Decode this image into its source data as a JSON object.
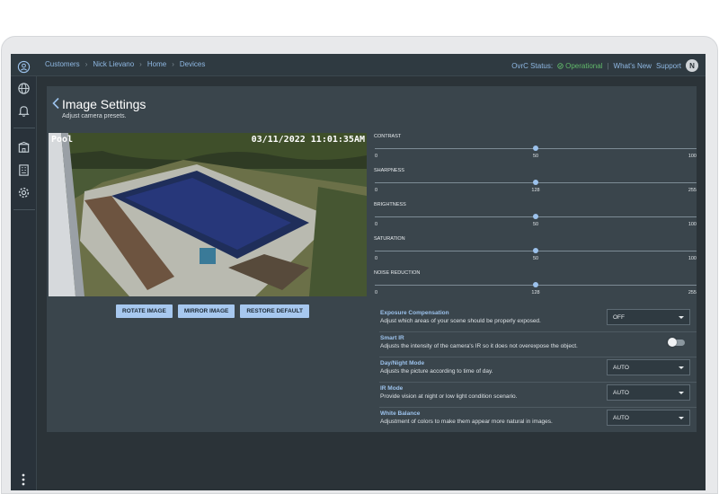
{
  "breadcrumbs": [
    "Customers",
    "Nick Lievano",
    "Home",
    "Devices"
  ],
  "status": {
    "label": "OvrC Status:",
    "value": "Operational",
    "whats_new": "What's New",
    "support": "Support",
    "avatar": "N"
  },
  "page": {
    "title": "Image Settings",
    "subtitle": "Adjust camera presets."
  },
  "camera": {
    "label": "Pool",
    "timestamp": "03/11/2022  11:01:35AM"
  },
  "buttons": {
    "rotate": "ROTATE IMAGE",
    "mirror": "MIRROR IMAGE",
    "restore": "RESTORE DEFAULT"
  },
  "sliders": [
    {
      "label": "CONTRAST",
      "min": "0",
      "value": "50",
      "max": "100",
      "fraction": 0.5
    },
    {
      "label": "SHARPNESS",
      "min": "0",
      "value": "128",
      "max": "255",
      "fraction": 0.5
    },
    {
      "label": "BRIGHTNESS",
      "min": "0",
      "value": "50",
      "max": "100",
      "fraction": 0.5
    },
    {
      "label": "SATURATION",
      "min": "0",
      "value": "50",
      "max": "100",
      "fraction": 0.5
    },
    {
      "label": "NOISE REDUCTION",
      "min": "0",
      "value": "128",
      "max": "255",
      "fraction": 0.5
    }
  ],
  "settings": [
    {
      "name": "Exposure Compensation",
      "desc": "Adjust which areas of your scene should be properly exposed.",
      "control": "select",
      "value": "OFF"
    },
    {
      "name": "Smart IR",
      "desc": "Adjusts the intensity of the camera's IR so it does not overexpose the object.",
      "control": "toggle",
      "value": "off"
    },
    {
      "name": "Day/Night Mode",
      "desc": "Adjusts the picture according to time of day.",
      "control": "select",
      "value": "AUTO"
    },
    {
      "name": "IR Mode",
      "desc": "Provide vision at night or low light condition scenario.",
      "control": "select",
      "value": "AUTO"
    },
    {
      "name": "White Balance",
      "desc": "Adjustment of colors to make them appear more natural in images.",
      "control": "select",
      "value": "AUTO"
    }
  ],
  "colors": {
    "accent": "#9cc2ec",
    "operational": "#61b86a",
    "background": "#2b3338",
    "panel": "#3a454c"
  },
  "icons": [
    "user-circle-icon",
    "globe-icon",
    "bell-icon",
    "building-icon",
    "office-icon",
    "gear-icon",
    "kebab-menu-icon",
    "chevron-left-icon",
    "check-circle-icon",
    "chevron-down-icon"
  ]
}
